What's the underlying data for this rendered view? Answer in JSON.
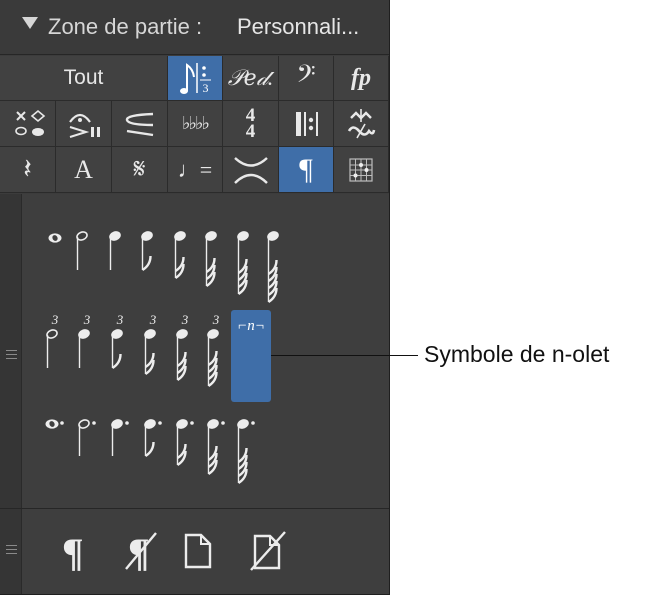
{
  "header": {
    "title": "Zone de partie :",
    "value": "Personnali..."
  },
  "toolbar": {
    "row1": [
      {
        "name": "tout-button",
        "label": "Tout",
        "selected": false
      },
      {
        "name": "tuplet-category-button",
        "icon": "tuplet-icon",
        "selected": true
      },
      {
        "name": "pedal-category-button",
        "label": "𝒫𝑒𝒹.",
        "icon": "pedal-icon",
        "selected": false
      },
      {
        "name": "clef-category-button",
        "label": "𝄢",
        "icon": "bass-clef-icon",
        "selected": false
      },
      {
        "name": "dynamics-category-button",
        "label": "fp",
        "icon": "dynamics-icon",
        "selected": false
      }
    ],
    "row2": [
      {
        "name": "noteheads-category-button",
        "icon": "noteheads-icon"
      },
      {
        "name": "articulation-category-button",
        "icon": "fermata-accent-icon"
      },
      {
        "name": "hairpin-category-button",
        "icon": "hairpin-icon"
      },
      {
        "name": "key-signature-category-button",
        "label": "♭♭♭♭",
        "icon": "flats-icon"
      },
      {
        "name": "time-signature-category-button",
        "label_top": "4",
        "label_bottom": "4",
        "icon": "time-signature-icon"
      },
      {
        "name": "repeat-category-button",
        "icon": "repeat-barline-icon"
      },
      {
        "name": "ornament-category-button",
        "icon": "ornament-icon"
      }
    ],
    "row3": [
      {
        "name": "rest-category-button",
        "label": "𝄽",
        "icon": "quarter-rest-icon",
        "selected": false
      },
      {
        "name": "text-category-button",
        "label": "A",
        "icon": "text-icon",
        "selected": false
      },
      {
        "name": "segno-category-button",
        "label": "𝄋",
        "icon": "segno-icon",
        "selected": false
      },
      {
        "name": "tempo-category-button",
        "label": "♩=",
        "icon": "tempo-icon",
        "selected": false
      },
      {
        "name": "slur-category-button",
        "icon": "slur-icon",
        "selected": false
      },
      {
        "name": "page-layout-category-button",
        "label": "¶",
        "icon": "pilcrow-icon",
        "selected": true
      },
      {
        "name": "chord-grid-category-button",
        "icon": "chord-grid-icon",
        "selected": false
      }
    ]
  },
  "palette": {
    "plain_notes": [
      "whole",
      "half",
      "quarter",
      "8th",
      "16th",
      "32nd",
      "64th",
      "128th"
    ],
    "tuplet_notes": {
      "count_label": "3",
      "values": [
        "half",
        "quarter",
        "8th",
        "16th",
        "32nd",
        "64th"
      ]
    },
    "tuplet_symbol_label": "⌐n¬",
    "dotted_notes": [
      "whole",
      "half",
      "quarter",
      "8th",
      "16th",
      "32nd",
      "64th"
    ]
  },
  "bottom": {
    "icons": [
      {
        "name": "page-break-icon",
        "label": "¶"
      },
      {
        "name": "remove-page-break-icon",
        "label": "¶"
      },
      {
        "name": "new-page-icon"
      },
      {
        "name": "remove-page-icon"
      }
    ]
  },
  "callout": {
    "label": "Symbole de n-olet"
  }
}
